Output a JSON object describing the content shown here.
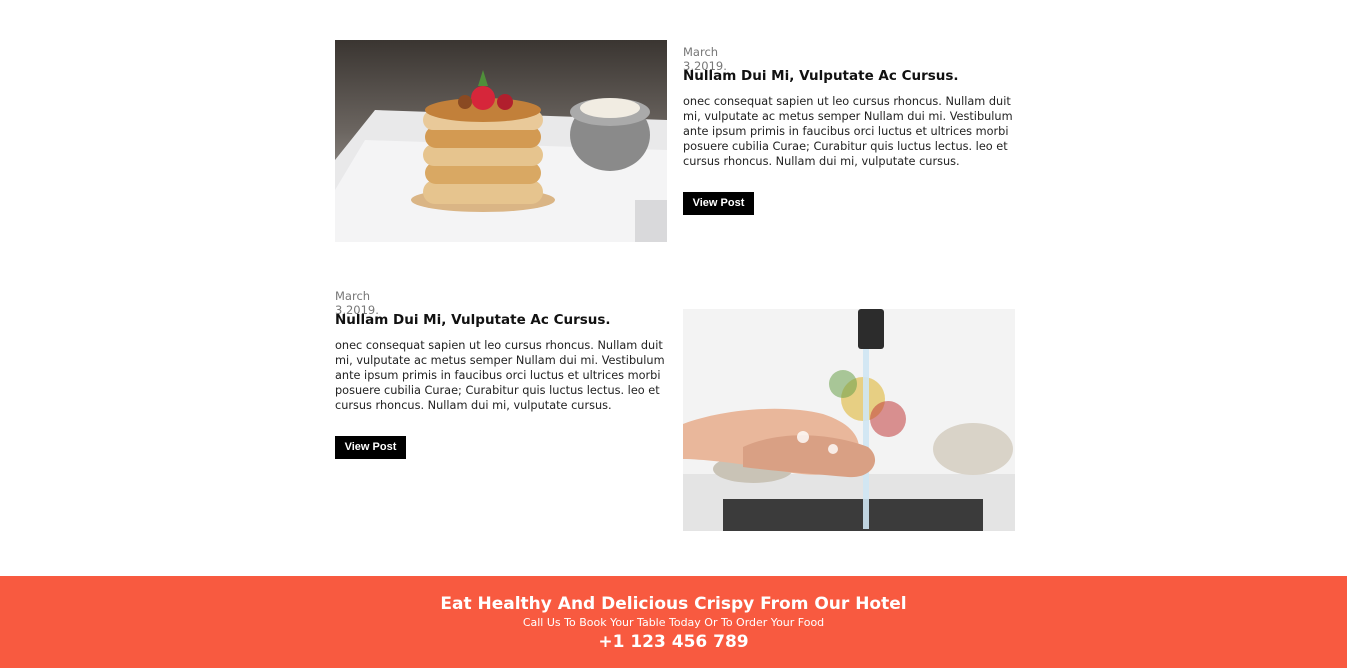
{
  "posts": [
    {
      "date": "March 3,2019.",
      "title": "Nullam Dui Mi, Vulputate Ac Cursus.",
      "body": "onec consequat sapien ut leo cursus rhoncus. Nullam duit mi, vulputate ac metus semper Nullam dui mi. Vestibulum ante ipsum primis in faucibus orci luctus et ultrices morbi posuere cubilia Curae; Curabitur quis luctus lectus. leo et cursus rhoncus. Nullam dui mi, vulputate cursus.",
      "button": "View Post"
    },
    {
      "date": "March 3,2019.",
      "title": "Nullam Dui Mi, Vulputate Ac Cursus.",
      "body": "onec consequat sapien ut leo cursus rhoncus. Nullam duit mi, vulputate ac metus semper Nullam dui mi. Vestibulum ante ipsum primis in faucibus orci luctus et ultrices morbi posuere cubilia Curae; Curabitur quis luctus lectus. leo et cursus rhoncus. Nullam dui mi, vulputate cursus.",
      "button": "View Post"
    }
  ],
  "footer": {
    "title": "Eat Healthy And Delicious Crispy From Our Hotel",
    "subtitle": "Call Us To Book Your Table Today Or To Order Your Food",
    "phone": "+1 123 456 789",
    "background": "#f85a40"
  }
}
